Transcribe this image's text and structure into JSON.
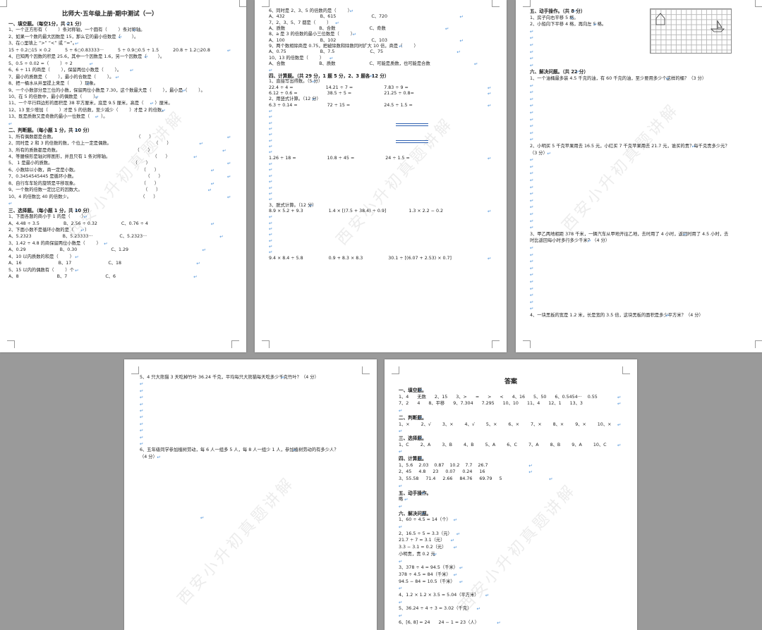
{
  "page1": {
    "title": "比师大·五年级上册·期中测试（一）",
    "lines": [
      {
        "b": true,
        "text": "一、填空题。（每空1分，共 21 分）"
      },
      {
        "text": "1、一个正方形有（        ）条对称轴，一个圆有（        ）条对称轴。"
      },
      {
        "text": "2、如果一个数的最大因数是 15，那么它的最小倍数是（        ）。"
      },
      {
        "text": "3、在○里填上 “>” “<” 或 “=”。"
      },
      {
        "text": "15 ÷ 0.2○15 × 0.2          5 ÷ 6○0.83333···          5 ÷ 0.9○0.5 ÷ 1.5          20.8 ÷ 1.2○20.8"
      },
      {
        "text": "4、已知两个因数的积是 25.6，其中一个因数是 1.6，另一个因数是（        ）。"
      },
      {
        "text": "5、0.5 ÷ 0.02 =（        ）÷ 2"
      },
      {
        "text": "6、6 ÷ 11 的商是（        ），保留两位小数是（        ）。"
      },
      {
        "text": "7、最小的质数是（        ），最小的合数是（        ）。"
      },
      {
        "text": "8、把一桶水从井里提上来是（        ）现象。"
      },
      {
        "text": "9、一个小数部分是三位的小数，保留两位小数是 7.30，这个数最大是（        ），最小是（        ）。"
      },
      {
        "text": "10、在 5 的倍数中，最小的偶数是（        ）。"
      },
      {
        "text": "11、一个平行四边形的面积是 38 平方厘米，底是 9.5 厘米，高是（        ）厘米。"
      },
      {
        "text": "12、13 至少增加（        ）才是 5 的倍数，至少减少（        ）才是 2 的倍数。"
      },
      {
        "text": "13、既是质数又是奇数的最小一位数是（        ）。"
      },
      {
        "text": ""
      },
      {
        "b": true,
        "text": "二、判断题。（每小题 1 分，共 10 分）"
      },
      {
        "text": "1、所有偶数都是合数。                                                         （      ）"
      },
      {
        "text": "2、同时是 2 和 3 的倍数的数，个位上一定是偶数。                              （      ）"
      },
      {
        "text": "3、所有的质数都是奇数。                                                     （      ）"
      },
      {
        "text": "4、等腰梯形是轴对称图形，并且只有 1 条对称轴。                              （      ）"
      },
      {
        "text": "5、 1 是最小的质数。                                                         （      ）"
      },
      {
        "text": "6、小数除以小数，商一定是小数。                                             （      ）"
      },
      {
        "text": "7、0.3454545445 是循环小数。                                                 （      ）"
      },
      {
        "text": "8、自行车车轮的旋转是平移现象。                                             （      ）"
      },
      {
        "text": "9、一个数的倍数一定比它的因数大。                                           （      ）"
      },
      {
        "text": "10、4 的倍数比 40 的倍数少。                                                 （      ）"
      },
      {
        "text": ""
      },
      {
        "b": true,
        "text": "三、选择题。（每小题 1 分，共 10 分）"
      },
      {
        "text": "1、下面各题的商小于 1 的是（        ）"
      },
      {
        "text": "A、4.48 ÷ 3.5                 B、2.56 ÷ 0.32                 C、0.76 ÷ 4"
      },
      {
        "text": "2、下面小数不是循环小数的是（        ）"
      },
      {
        "text": "A、5.2323                      B、5.23333···                   C、5.2323···"
      },
      {
        "text": "3、1.42 ÷ 4.8 的商保留两位小数是（        ）"
      },
      {
        "text": "A、0.29                        B、0.30                        C、1.29"
      },
      {
        "text": "4、10 以内质数的和是（        ）"
      },
      {
        "text": "A、16                          B、17                          C、18"
      },
      {
        "text": "5、15 以内的偶数有（        ）个"
      },
      {
        "text": "A、8                           B、7                           C、6"
      }
    ]
  },
  "page2": {
    "lines": [
      {
        "text": "6、同时是 2、3、5 的倍数的是（        ）"
      },
      {
        "text": "A、432                         B、615                         C、720"
      },
      {
        "text": "7、2、3、5、7 都是（        ）"
      },
      {
        "text": "A、质数                        B、合数                        C、奇数"
      },
      {
        "text": "8、a 是 3 的倍数的最小三位数是（        ）"
      },
      {
        "text": "A、100                         B、102                         C、103"
      },
      {
        "text": "9、两个数相除商是 0.75，把被除数和除数同时扩大 10 倍，商是（        ）"
      },
      {
        "text": "A、0.75                        B、7.5                         C、75"
      },
      {
        "text": "10、13 的倍数是（        ）"
      },
      {
        "text": "A、合数                        B、质数                        C、可能是质数，也可能是合数"
      },
      {
        "text": ""
      },
      {
        "b": true,
        "text": "四、计算题。（共 29 分，1 题 5 分，2、3 题各 12 分）"
      },
      {
        "text": "1、直接写出得数。（5 分）"
      },
      {
        "text": "22.4 ÷ 4 =                       14.21 ÷ 7 =                      7.83 ÷ 9 ="
      },
      {
        "text": "6.12 ÷ 0.6 =                     38.5 ÷ 5 =                       21.25 ÷ 0.8="
      },
      {
        "text": "2、用竖式计算。（12 分）"
      },
      {
        "text": "6.3 ÷ 0.14 =                     72 ÷ 15 =                        24.5 ÷ 1.5 ="
      },
      {
        "text": ""
      },
      {
        "text": ""
      },
      {
        "text": ""
      },
      {
        "text": ""
      },
      {
        "text": ""
      },
      {
        "text": ""
      },
      {
        "text": ""
      },
      {
        "text": ""
      },
      {
        "text": "1.26 ÷ 18 =                      10.8 ÷ 45 =                      24 ÷ 1.5 ="
      },
      {
        "text": ""
      },
      {
        "text": ""
      },
      {
        "text": ""
      },
      {
        "text": ""
      },
      {
        "text": ""
      },
      {
        "text": ""
      },
      {
        "text": ""
      },
      {
        "text": "3、脱式计算。（12 分）"
      },
      {
        "text": "8.9 × 5.2 + 9.3                  1.4 × [(7.5 + 38.4) ÷ 0.9]                1.3 × 2.2 − 0.2"
      },
      {
        "text": ""
      },
      {
        "text": ""
      },
      {
        "text": ""
      },
      {
        "text": ""
      },
      {
        "text": ""
      },
      {
        "text": ""
      },
      {
        "text": ""
      },
      {
        "text": "9.4 × 8.4 ÷ 5.8                  0.9 + 8.3 × 8.3                  30.1 ÷ [(6.07 + 2.53) × 0.7]"
      }
    ]
  },
  "page3": {
    "lines": [
      {
        "b": true,
        "text": "五、动手操作。（共 8 分）"
      },
      {
        "text": "1、房子向右平移 5 格。"
      },
      {
        "text": "2、小船向下平移 4 格，再向左 5 格。"
      },
      {
        "text": ""
      },
      {
        "text": ""
      },
      {
        "text": ""
      },
      {
        "text": ""
      },
      {
        "text": ""
      },
      {
        "text": ""
      },
      {
        "b": true,
        "text": "六、解决问题。（共 22 分）"
      },
      {
        "text": "1、一个油桶最多装 4.5 千克的油，有 60 千克的油，至少要用多少个这样的桶？（3 分）"
      },
      {
        "text": ""
      },
      {
        "text": ""
      },
      {
        "text": ""
      },
      {
        "text": ""
      },
      {
        "text": ""
      },
      {
        "text": ""
      },
      {
        "text": ""
      },
      {
        "text": ""
      },
      {
        "text": ""
      },
      {
        "text": "2、小明买 5 千克苹果用去 16.5 元，小红买 7 千克苹果用去 21.7 元，谁买的贵？每千克贵多少元？"
      },
      {
        "text": "（3 分）"
      },
      {
        "text": ""
      },
      {
        "text": ""
      },
      {
        "text": ""
      },
      {
        "text": ""
      },
      {
        "text": ""
      },
      {
        "text": ""
      },
      {
        "text": ""
      },
      {
        "text": ""
      },
      {
        "text": ""
      },
      {
        "text": ""
      },
      {
        "text": ""
      },
      {
        "text": "3、甲乙两地相距 378 千米，一辆汽车从甲地开往乙地，去时用了 4 小时，返回时用了 4.5 小时，去"
      },
      {
        "text": "时比返回每小时多行多少千米？（4 分）"
      },
      {
        "text": ""
      },
      {
        "text": ""
      },
      {
        "text": ""
      },
      {
        "text": ""
      },
      {
        "text": ""
      },
      {
        "text": ""
      },
      {
        "text": ""
      },
      {
        "text": ""
      },
      {
        "text": ""
      },
      {
        "text": ""
      },
      {
        "text": "4、一块黑板的宽是 1.2 米，长是宽的 3.5 倍，这块黑板的面积是多少平方米？（4 分）"
      }
    ]
  },
  "page4": {
    "lines": [
      {
        "text": "5、4 只大熊猫 3 天吃掉竹叶 36.24 千克，平均每只大熊猫每天吃多少千克竹叶？（4 分）"
      },
      {
        "text": ""
      },
      {
        "text": ""
      },
      {
        "text": ""
      },
      {
        "text": ""
      },
      {
        "text": ""
      },
      {
        "text": ""
      },
      {
        "text": ""
      },
      {
        "text": ""
      },
      {
        "text": ""
      },
      {
        "text": ""
      },
      {
        "text": "6、五年级同学参加植树劳动，每 6 人一组多 5 人，每 8 人一组少 1 人，参加植树劳动的有多少人？"
      },
      {
        "text": "（4 分）"
      }
    ]
  },
  "page5": {
    "title": "答案",
    "lines": [
      {
        "b": true,
        "text": "一、填空题。"
      },
      {
        "text": "1、4      无数      2、15      3、>      =      >      <      4、16      5、50      6、0.5454···    0.55"
      },
      {
        "text": "7、2      4      8、平移      9、7.304      7.295      10、10      11、4      12、1      13、3"
      },
      {
        "text": ""
      },
      {
        "b": true,
        "text": "二、判断题。"
      },
      {
        "text": "1、×        2、√        3、×        4、√        5、×        6、×        7、×        8、×        9、×        10、×"
      },
      {
        "text": ""
      },
      {
        "b": true,
        "text": "三、选择题。"
      },
      {
        "text": "1、C        2、A        3、B        4、B        5、A        6、C        7、A        8、B        9、A        10、C"
      },
      {
        "text": ""
      },
      {
        "b": true,
        "text": "四、计算题。"
      },
      {
        "text": "1、5.6    2.03    0.87    10.2    7.7    26.7"
      },
      {
        "text": "2、45     4.8     23     0.07     0.24     16"
      },
      {
        "text": "3、55.58     71.4     2.66     84.76     69.79     5"
      },
      {
        "text": ""
      },
      {
        "b": true,
        "text": "五、动手操作。"
      },
      {
        "text": "略"
      },
      {
        "text": ""
      },
      {
        "b": true,
        "text": "六、解决问题。"
      },
      {
        "text": "1、60 ÷ 4.5 ≈ 14（个）"
      },
      {
        "text": ""
      },
      {
        "text": "2、16.5 ÷ 5 = 3.3（元）"
      },
      {
        "text": "21.7 ÷ 7 = 3.1（元）"
      },
      {
        "text": "3.3 − 3.1 = 0.2（元）"
      },
      {
        "text": "小明贵，贵 0.2 元"
      },
      {
        "text": ""
      },
      {
        "text": "3、378 ÷ 4 = 94.5（千米）"
      },
      {
        "text": "378 ÷ 4.5 = 84（千米）"
      },
      {
        "text": "94.5 − 84 = 10.5（千米）"
      },
      {
        "text": ""
      },
      {
        "text": "4、1.2 × 1.2 × 3.5 = 5.04（平方米）"
      },
      {
        "text": ""
      },
      {
        "text": "5、36.24 ÷ 4 ÷ 3 = 3.02（千克）"
      },
      {
        "text": ""
      },
      {
        "text": "6、[6, 8] = 24      24 − 1 = 23（人）"
      }
    ]
  },
  "watermark": "西安小升初真题讲解",
  "colors": {
    "background": "#9a9a9a",
    "page": "#ffffff",
    "paragraph_mark": "#4a90d9"
  }
}
